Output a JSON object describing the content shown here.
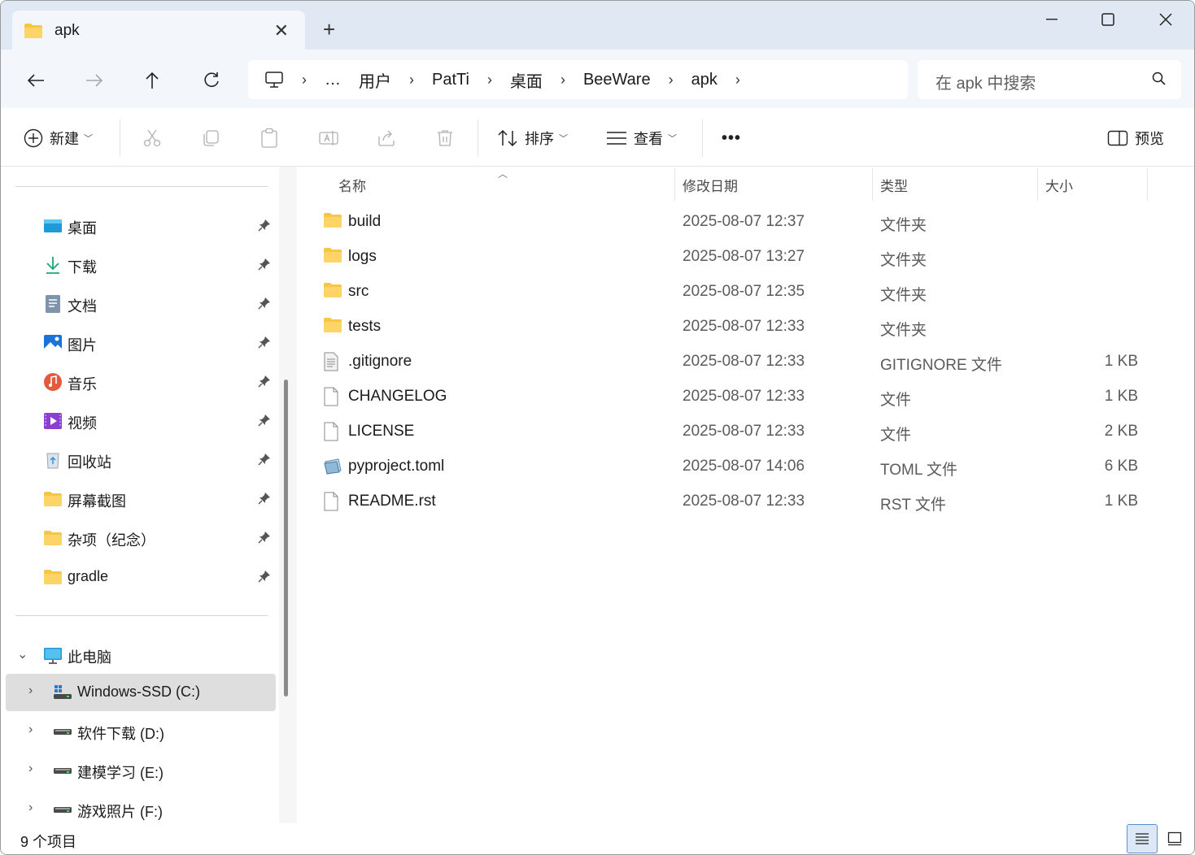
{
  "tab": {
    "title": "apk"
  },
  "address": {
    "crumbs": [
      "…",
      "用户",
      "PatTi",
      "桌面",
      "BeeWare",
      "apk"
    ]
  },
  "search": {
    "placeholder": "在 apk 中搜索"
  },
  "toolbar": {
    "new_label": "新建",
    "sort_label": "排序",
    "view_label": "查看",
    "more_label": "•••",
    "preview_label": "预览"
  },
  "sidebar": {
    "quick": [
      {
        "label": "桌面",
        "icon": "desktop-icon"
      },
      {
        "label": "下载",
        "icon": "download-icon"
      },
      {
        "label": "文档",
        "icon": "document-icon"
      },
      {
        "label": "图片",
        "icon": "pictures-icon"
      },
      {
        "label": "音乐",
        "icon": "music-icon"
      },
      {
        "label": "视频",
        "icon": "videos-icon"
      },
      {
        "label": "回收站",
        "icon": "recycle-bin-icon"
      },
      {
        "label": "屏幕截图",
        "icon": "folder-icon"
      },
      {
        "label": "杂项（纪念）",
        "icon": "folder-icon"
      },
      {
        "label": "gradle",
        "icon": "folder-icon"
      }
    ],
    "this_pc": "此电脑",
    "drives": [
      {
        "label": "Windows-SSD (C:)"
      },
      {
        "label": "软件下载 (D:)"
      },
      {
        "label": "建模学习 (E:)"
      },
      {
        "label": "游戏照片 (F:)"
      }
    ]
  },
  "columns": {
    "name": "名称",
    "date": "修改日期",
    "type": "类型",
    "size": "大小"
  },
  "files": [
    {
      "name": "build",
      "date": "2025-08-07 12:37",
      "type": "文件夹",
      "size": "",
      "kind": "folder"
    },
    {
      "name": "logs",
      "date": "2025-08-07 13:27",
      "type": "文件夹",
      "size": "",
      "kind": "folder"
    },
    {
      "name": "src",
      "date": "2025-08-07 12:35",
      "type": "文件夹",
      "size": "",
      "kind": "folder"
    },
    {
      "name": "tests",
      "date": "2025-08-07 12:33",
      "type": "文件夹",
      "size": "",
      "kind": "folder"
    },
    {
      "name": ".gitignore",
      "date": "2025-08-07 12:33",
      "type": "GITIGNORE 文件",
      "size": "1 KB",
      "kind": "text"
    },
    {
      "name": "CHANGELOG",
      "date": "2025-08-07 12:33",
      "type": "文件",
      "size": "1 KB",
      "kind": "file"
    },
    {
      "name": "LICENSE",
      "date": "2025-08-07 12:33",
      "type": "文件",
      "size": "2 KB",
      "kind": "file"
    },
    {
      "name": "pyproject.toml",
      "date": "2025-08-07 14:06",
      "type": "TOML 文件",
      "size": "6 KB",
      "kind": "toml"
    },
    {
      "name": "README.rst",
      "date": "2025-08-07 12:33",
      "type": "RST 文件",
      "size": "1 KB",
      "kind": "file"
    }
  ],
  "status": {
    "count": "9 个项目"
  },
  "colors": {
    "folder": "#f6c644",
    "accent": "#005fb8"
  }
}
